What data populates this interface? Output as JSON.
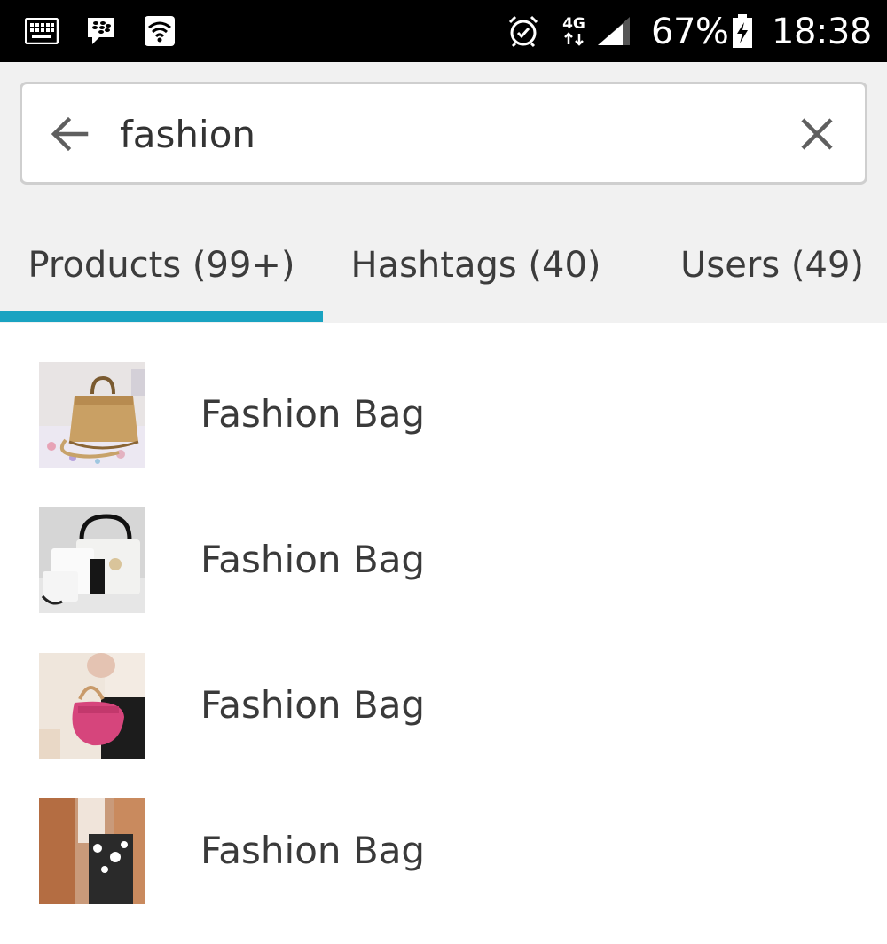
{
  "status_bar": {
    "icons": [
      "keyboard-icon",
      "blackberry-icon",
      "wifi-icon",
      "alarm-icon",
      "network-4g-icon",
      "signal-icon",
      "battery-charging-icon"
    ],
    "network_label": "4G",
    "battery_percent": "67%",
    "time": "18:38"
  },
  "search": {
    "query": "fashion",
    "back_icon": "arrow-left-icon",
    "clear_icon": "close-icon"
  },
  "tabs": [
    {
      "label": "Products (99+)",
      "active": true
    },
    {
      "label": "Hashtags (40)",
      "active": false
    },
    {
      "label": "Users (49)",
      "active": false
    }
  ],
  "accent_color": "#1aa3c1",
  "results": [
    {
      "label": "Fashion Bag",
      "thumbnail": "tan-handbag-photo"
    },
    {
      "label": "Fashion Bag",
      "thumbnail": "white-handbag-set-photo"
    },
    {
      "label": "Fashion Bag",
      "thumbnail": "pink-handbag-photo"
    },
    {
      "label": "Fashion Bag",
      "thumbnail": "floral-handbag-photo"
    }
  ]
}
